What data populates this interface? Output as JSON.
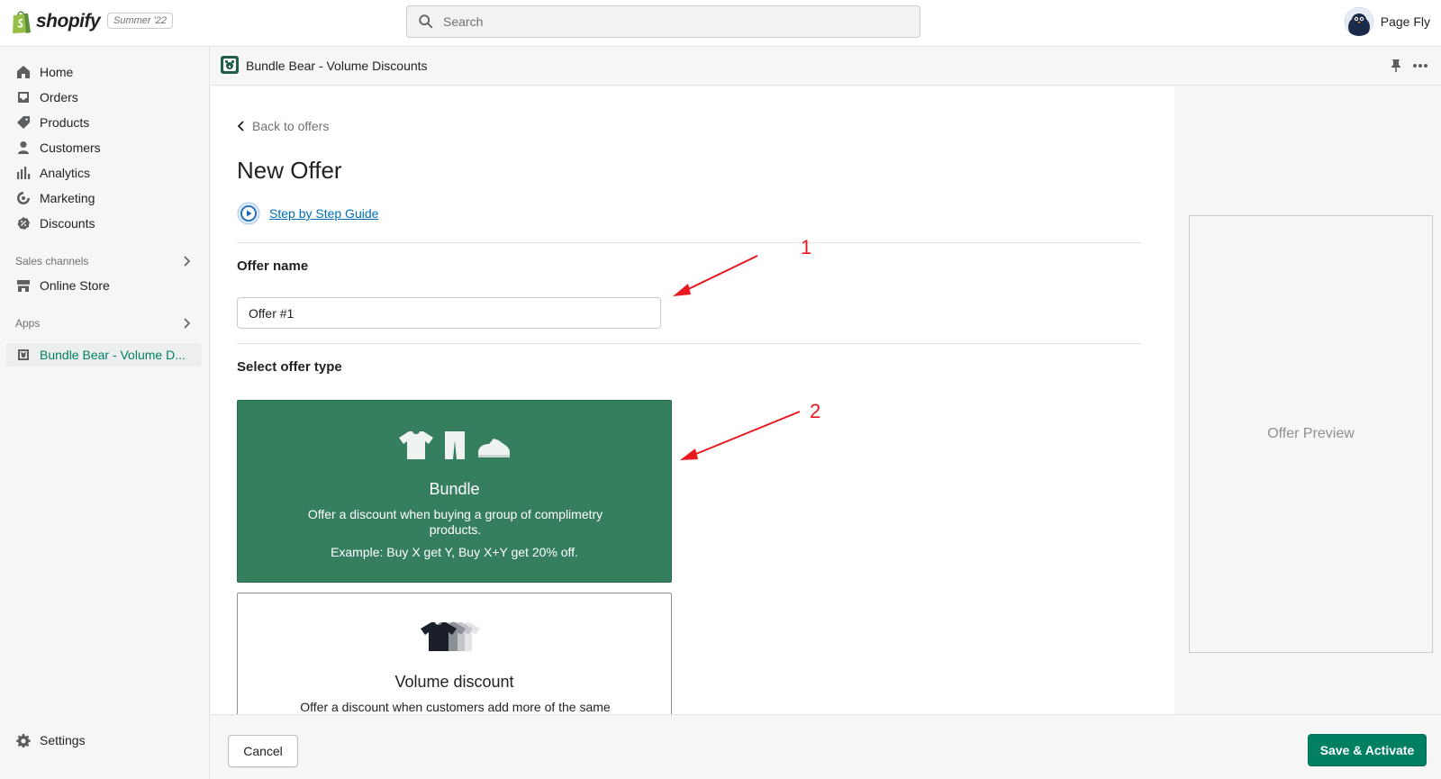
{
  "topbar": {
    "brand": "shopify",
    "edition": "Summer '22",
    "search_placeholder": "Search",
    "user_name": "Page Fly"
  },
  "sidebar": {
    "items": [
      {
        "label": "Home",
        "icon": "home-icon"
      },
      {
        "label": "Orders",
        "icon": "orders-icon"
      },
      {
        "label": "Products",
        "icon": "tag-icon"
      },
      {
        "label": "Customers",
        "icon": "person-icon"
      },
      {
        "label": "Analytics",
        "icon": "bar-chart-icon"
      },
      {
        "label": "Marketing",
        "icon": "target-icon"
      },
      {
        "label": "Discounts",
        "icon": "discount-icon"
      }
    ],
    "sales_channels_title": "Sales channels",
    "online_store": "Online Store",
    "apps_title": "Apps",
    "active_app": "Bundle Bear - Volume D...",
    "settings": "Settings"
  },
  "app_header": {
    "title": "Bundle Bear - Volume Discounts"
  },
  "main": {
    "back_link": "Back to offers",
    "page_title": "New Offer",
    "guide_link": "Step by Step Guide",
    "offer_name_label": "Offer name",
    "offer_name_value": "Offer #1",
    "offer_type_label": "Select offer type",
    "bundle": {
      "title": "Bundle",
      "description": "Offer a discount when buying a group of complimetry products.",
      "example": "Example: Buy X get Y, Buy X+Y get 20% off."
    },
    "volume": {
      "title": "Volume discount",
      "description": "Offer a discount when customers add more of the same"
    }
  },
  "annotations": {
    "first": "1",
    "second": "2"
  },
  "preview": {
    "label": "Offer Preview"
  },
  "footer": {
    "cancel": "Cancel",
    "save": "Save & Activate"
  },
  "colors": {
    "brand_green": "#008060",
    "bundle_card": "#357f5f",
    "link_blue": "#006fbb",
    "annotation_red": "#e8181e"
  }
}
